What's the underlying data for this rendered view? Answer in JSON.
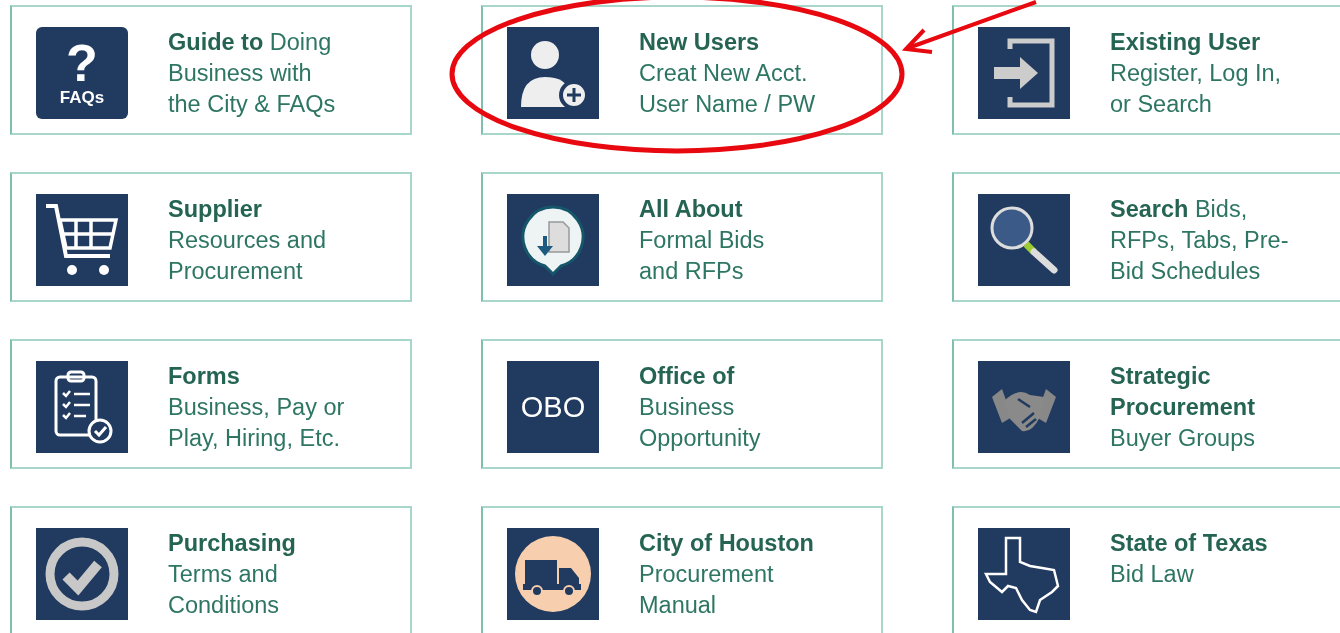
{
  "tiles": [
    {
      "kind": "faq",
      "icon_texts": [
        "?",
        "FAQs"
      ],
      "lines": [
        "**Guide to** Doing",
        "Business with",
        "the City & FAQs"
      ]
    },
    {
      "kind": "new-user",
      "lines": [
        "**New Users**",
        "Creat New Acct.",
        "User Name / PW"
      ]
    },
    {
      "kind": "login",
      "lines": [
        "**Existing User**",
        "Register, Log In,",
        "or Search"
      ]
    },
    {
      "kind": "cart",
      "lines": [
        "**Supplier**",
        "Resources and",
        "Procurement"
      ]
    },
    {
      "kind": "bid-doc",
      "lines": [
        "**All About**",
        "Formal Bids",
        "and RFPs"
      ]
    },
    {
      "kind": "search",
      "lines": [
        "**Search** Bids,",
        "RFPs, Tabs, Pre-",
        "Bid Schedules"
      ]
    },
    {
      "kind": "forms",
      "lines": [
        "**Forms**",
        "Business, Pay or",
        "Play, Hiring, Etc."
      ]
    },
    {
      "kind": "obo",
      "icon_texts": [
        "OBO"
      ],
      "lines": [
        "**Office of**",
        "Business",
        "Opportunity"
      ]
    },
    {
      "kind": "handshake",
      "lines": [
        "**Strategic**",
        "**Procurement**",
        "Buyer Groups"
      ]
    },
    {
      "kind": "check",
      "lines": [
        "**Purchasing**",
        "Terms and",
        "Conditions"
      ]
    },
    {
      "kind": "truck",
      "lines": [
        "**City of Houston**",
        "Procurement",
        "Manual"
      ]
    },
    {
      "kind": "texas",
      "lines": [
        "**State of Texas**",
        "Bid Law"
      ]
    }
  ],
  "annotation": {
    "kind": "ellipse-with-arrow"
  }
}
